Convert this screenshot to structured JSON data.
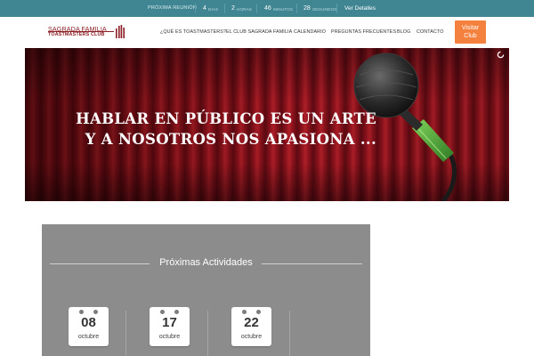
{
  "topbar": {
    "next_meeting_label": "PRÓXIMA REUNIÓN",
    "countdown": [
      {
        "value": "4",
        "unit": "DIAS"
      },
      {
        "value": "2",
        "unit": "HORAS"
      },
      {
        "value": "46",
        "unit": "MINUTOS"
      },
      {
        "value": "28",
        "unit": "SEGUNDOS"
      }
    ],
    "details_link": "Ver Detalles",
    "color": "#3f8592"
  },
  "logo": {
    "line1": "SAGRADA FAMILIA",
    "line2": "TOASTMASTERS CLUB",
    "color": "#8b1e24"
  },
  "nav": {
    "items": [
      "¿QUÉ ES TOASTMASTERS?",
      "EL CLUB SAGRADA FAMILIA",
      "CALENDARIO",
      "PREGUNTAS FRECUENTES",
      "BLOG",
      "CONTACTO"
    ],
    "cta_line1": "Visitar",
    "cta_line2": "Club",
    "cta_color": "#f5813e"
  },
  "hero": {
    "line1": "HABLAR EN PÚBLICO ES UN ARTE",
    "line2": "Y A NOSOTROS NOS APASIONA ..."
  },
  "activities": {
    "title": "Próximas Actividades",
    "dates": [
      {
        "day": "08",
        "month": "octubre"
      },
      {
        "day": "17",
        "month": "octubre"
      },
      {
        "day": "22",
        "month": "octubre"
      }
    ]
  }
}
